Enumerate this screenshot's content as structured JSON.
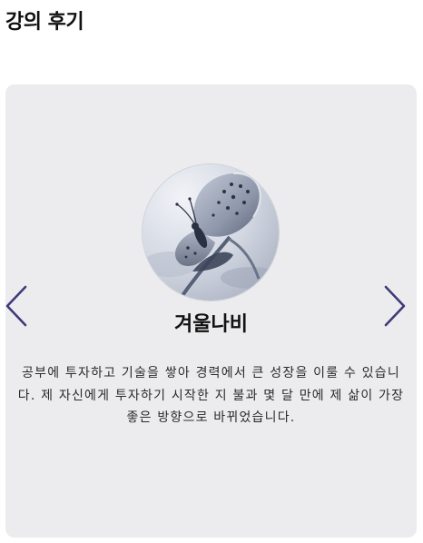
{
  "section": {
    "title": "강의 후기"
  },
  "review": {
    "reviewer_name": "겨울나비",
    "text": "공부에 투자하고 기술을 쌓아 경력에서 큰 성장을 이룰 수 있습니다. 제 자신에게 투자하기 시작한 지 불과 몇 달 만에 제 삶이 가장 좋은 방향으로 바뀌었습니다.",
    "avatar_image": "butterfly-photo"
  },
  "carousel": {
    "prev_icon": "chevron-left-icon",
    "next_icon": "chevron-right-icon",
    "arrow_color": "#3d3a7a"
  },
  "colors": {
    "card_background": "#ececee",
    "text": "#111111"
  }
}
